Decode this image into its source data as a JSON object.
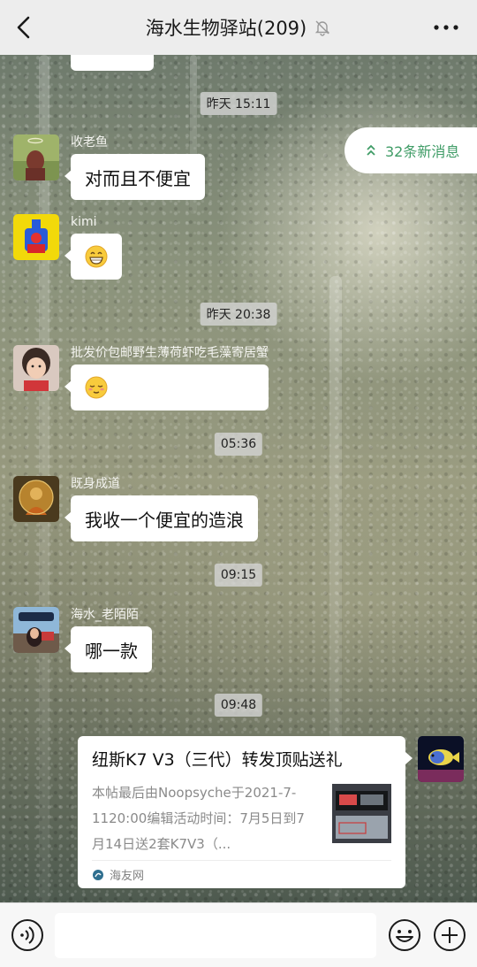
{
  "header": {
    "title": "海水生物驿站(209)"
  },
  "new_messages": {
    "label": "32条新消息"
  },
  "messages": [
    {
      "timestamp": "昨天 15:11"
    },
    {
      "sender": "收老鱼",
      "text": "对而且不便宜"
    },
    {
      "sender": "kimi",
      "emoji": "grinning-face-icon"
    },
    {
      "timestamp": "昨天 20:38"
    },
    {
      "sender": "批发价包邮野生薄荷虾吃毛藻寄居蟹",
      "emoji": "relieved-face-icon"
    },
    {
      "timestamp": "05:36"
    },
    {
      "sender": "既身成道",
      "text": "我收一个便宜的造浪"
    },
    {
      "timestamp": "09:15"
    },
    {
      "sender": "海水_老陌陌",
      "text": "哪一款"
    },
    {
      "timestamp": "09:48"
    }
  ],
  "link_card": {
    "title": "纽斯K7 V3（三代）转发顶贴送礼",
    "description": "本帖最后由Noopsyche于2021-7-1120:00编辑活动时间：7月5日到7月14日送2套K7V3（...",
    "source": "海友网"
  },
  "colors": {
    "accent_green": "#3f9c66",
    "header_bg": "#ededed",
    "bubble": "#ffffff",
    "timestamp_bg": "#d6d6d6"
  }
}
